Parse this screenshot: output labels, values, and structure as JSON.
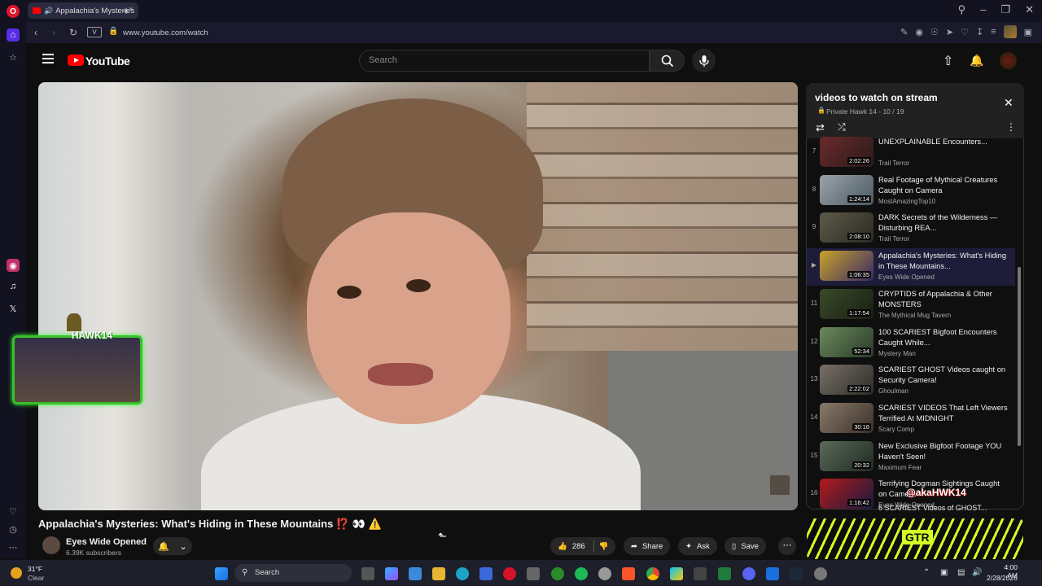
{
  "browser": {
    "tab_title": "Appalachia's Mysteries",
    "url": "www.youtube.com/watch",
    "view_badge": "V"
  },
  "youtube": {
    "logo_text": "YouTube",
    "search_placeholder": "Search"
  },
  "video": {
    "title": "Appalachia's Mysteries: What's Hiding in These Mountains ⁉️ 👀 ⚠️",
    "channel": "Eyes Wide Opened",
    "subscribers": "6.39K subscribers",
    "likes": "286",
    "share_label": "Share",
    "ask_label": "Ask",
    "save_label": "Save"
  },
  "overlay": {
    "streamer_name": "HAWK14",
    "handle": "@akaHWK14"
  },
  "playlist": {
    "title": "videos to watch on stream",
    "subtitle": "Private Hawk 14 - 10 / 19",
    "items": [
      {
        "num": "7",
        "title": "UNEXPLAINABLE Encounters...",
        "channel": "Trail Terror",
        "duration": "2:02:26",
        "c1": "#6b2a2a",
        "c2": "#2a1a1a"
      },
      {
        "num": "8",
        "title": "Real Footage of Mythical Creatures Caught on Camera",
        "channel": "MostAmazingTop10",
        "duration": "1:24:14",
        "c1": "#9aa3aa",
        "c2": "#4b5a63"
      },
      {
        "num": "9",
        "title": "DARK Secrets of the Wilderness — Disturbing REA...",
        "channel": "Trail Terror",
        "duration": "2:08:10",
        "c1": "#5e5a4a",
        "c2": "#2b2a22"
      },
      {
        "num": "▶",
        "title": "Appalachia's Mysteries: What's Hiding in These Mountains...",
        "channel": "Eyes Wide Opened",
        "duration": "1:06:35",
        "c1": "#c8a22a",
        "c2": "#3a2a66"
      },
      {
        "num": "11",
        "title": "CRYPTIDS of Appalachia & Other MONSTERS",
        "channel": "The Mythical Mug Tavern",
        "duration": "1:17:54",
        "c1": "#3a4a2a",
        "c2": "#1a1f12"
      },
      {
        "num": "12",
        "title": "100 SCARIEST Bigfoot Encounters Caught While...",
        "channel": "Mystery Man",
        "duration": "52:34",
        "c1": "#6a8a5a",
        "c2": "#2a3a2a"
      },
      {
        "num": "13",
        "title": "SCARIEST GHOST Videos caught on Security Camera!",
        "channel": "Ghoulman",
        "duration": "2:22:02",
        "c1": "#777068",
        "c2": "#2f2c28"
      },
      {
        "num": "14",
        "title": "SCARIEST VIDEOS That Left Viewers Terrified At MIDNIGHT",
        "channel": "Scary Comp",
        "duration": "30:16",
        "c1": "#8a7a6a",
        "c2": "#3a2f28"
      },
      {
        "num": "15",
        "title": "New Exclusive Bigfoot Footage YOU Haven't Seen!",
        "channel": "Maximum Fear",
        "duration": "20:32",
        "c1": "#5a6a5a",
        "c2": "#1f2a22"
      },
      {
        "num": "16",
        "title": "Terrifying Dogman Sightings Caught on Camera",
        "channel": "Eyes Wide Opened",
        "duration": "1:16:42",
        "c1": "#b31b1b",
        "c2": "#1a1a40"
      }
    ],
    "last_item_partial": "6 SCARIEST Videos of GHOST..."
  },
  "banner": {
    "logo": "GTR"
  },
  "taskbar": {
    "temperature": "31°F",
    "weather": "Clear",
    "search_label": "Search",
    "time": "4:00 AM",
    "date": "2/28/2026"
  }
}
